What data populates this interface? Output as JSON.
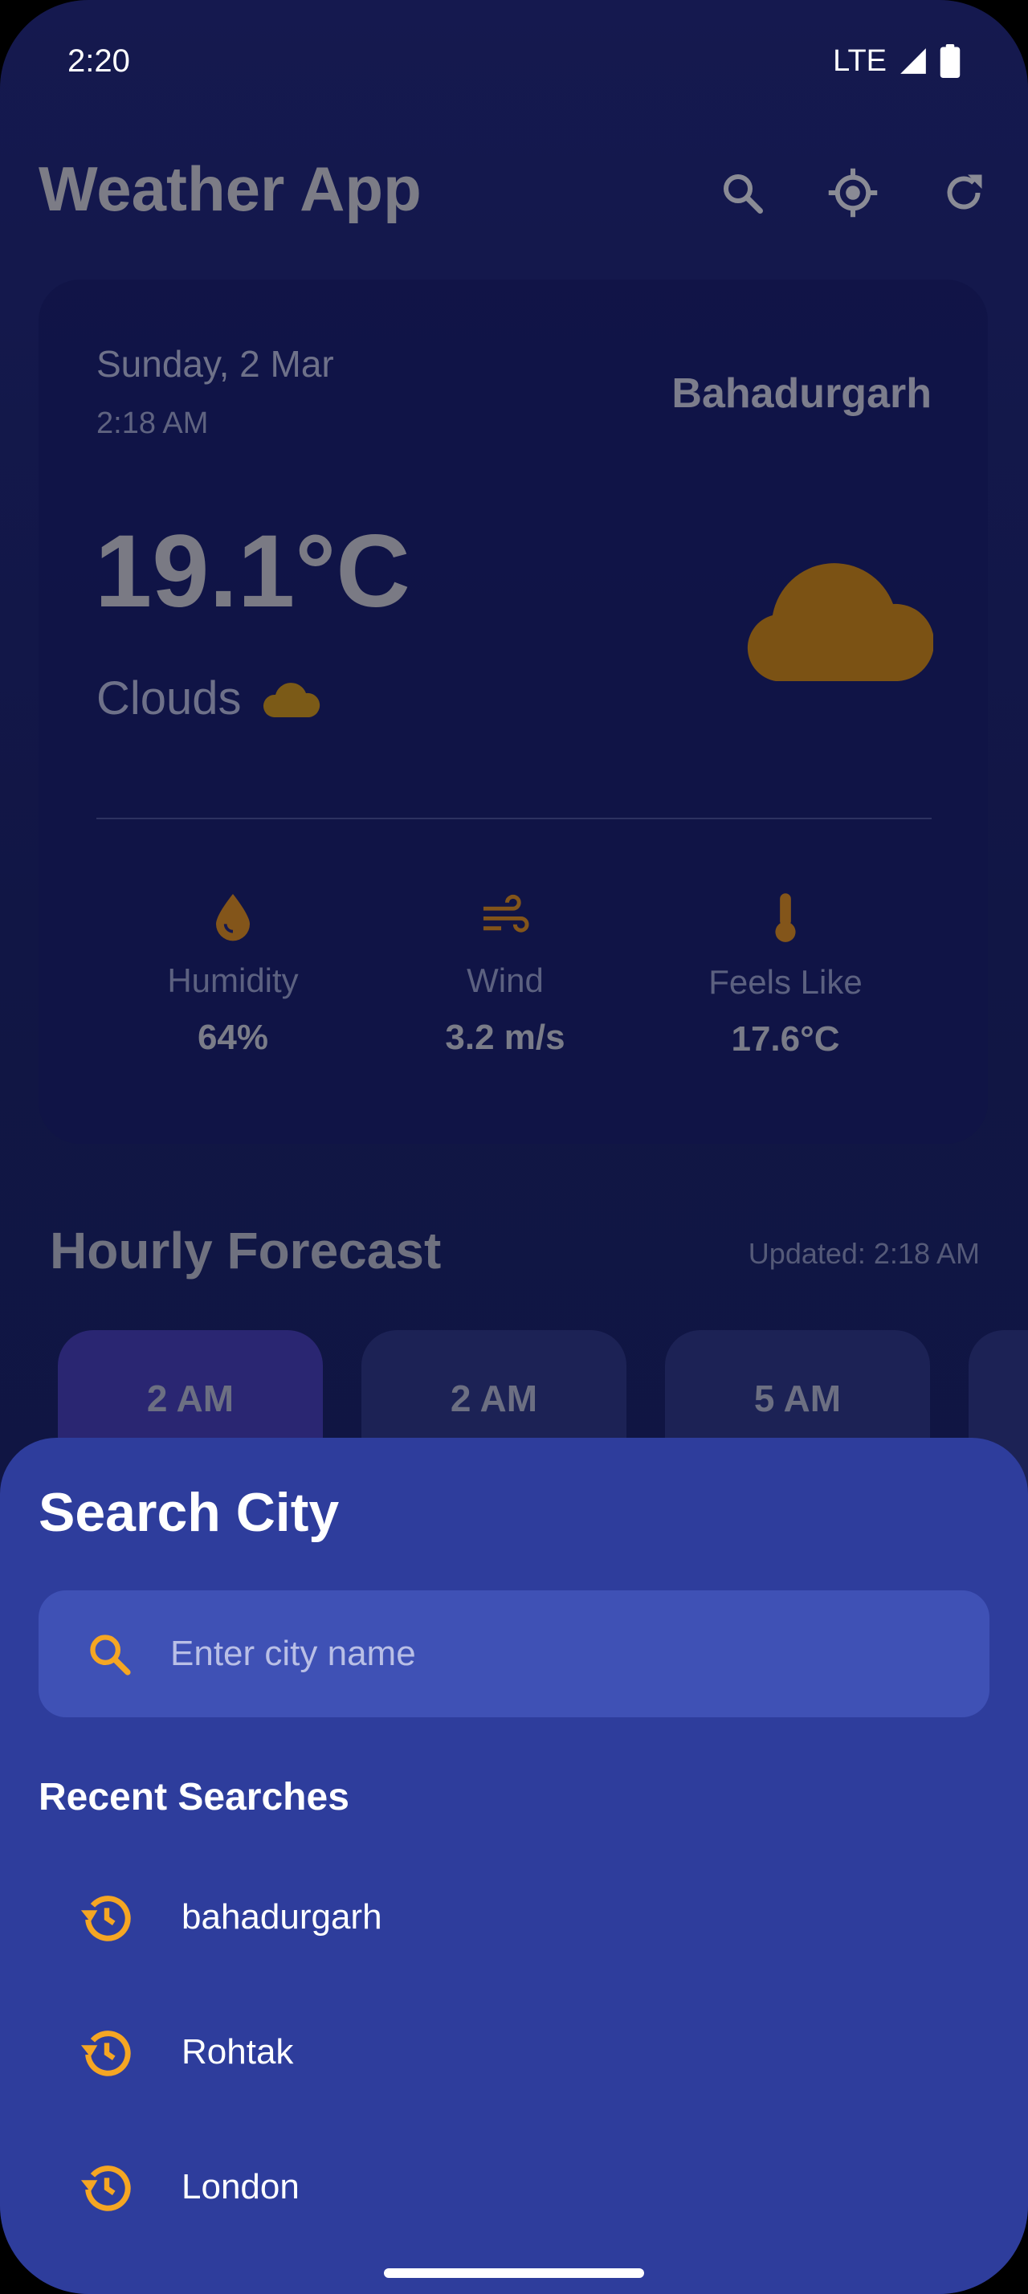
{
  "status_bar": {
    "time": "2:20",
    "network": "LTE"
  },
  "header": {
    "title": "Weather App",
    "icons": [
      "search-icon",
      "my-location-icon",
      "refresh-icon"
    ]
  },
  "weather": {
    "date": "Sunday, 2 Mar",
    "time": "2:18 AM",
    "city": "Bahadurgarh",
    "temperature": "19.1°C",
    "condition": "Clouds",
    "stats": [
      {
        "icon": "humidity-icon",
        "label": "Humidity",
        "value": "64%"
      },
      {
        "icon": "wind-icon",
        "label": "Wind",
        "value": "3.2 m/s"
      },
      {
        "icon": "thermometer-icon",
        "label": "Feels Like",
        "value": "17.6°C"
      }
    ]
  },
  "hourly": {
    "title": "Hourly Forecast",
    "updated": "Updated: 2:18 AM",
    "items": [
      {
        "time": "2 AM"
      },
      {
        "time": "2 AM"
      },
      {
        "time": "5 AM"
      }
    ]
  },
  "search_sheet": {
    "title": "Search City",
    "placeholder": "Enter city name",
    "recent_title": "Recent Searches",
    "recent": [
      {
        "city": "bahadurgarh"
      },
      {
        "city": "Rohtak"
      },
      {
        "city": "London"
      }
    ]
  },
  "colors": {
    "accent": "#f5a623",
    "sheet": "#2e3d9c",
    "input": "#3f51b5",
    "background": "#121748"
  }
}
